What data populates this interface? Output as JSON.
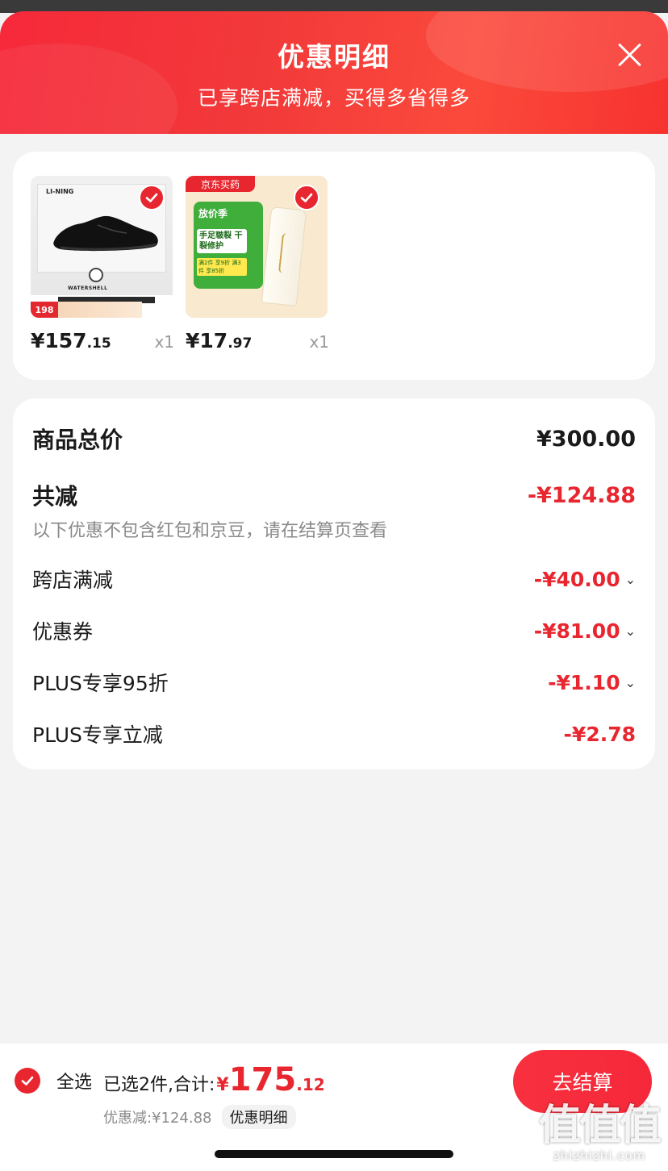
{
  "header": {
    "title": "优惠明细",
    "subtitle": "已享跨店满减，买得多省得多"
  },
  "products": [
    {
      "name": "shoe",
      "price_int": "¥157",
      "price_dec": ".15",
      "qty": "x1",
      "brand": "LI-NING",
      "tag": "WATERSHELL",
      "promo_price": "198"
    },
    {
      "name": "cream",
      "price_int": "¥17",
      "price_dec": ".97",
      "qty": "x1",
      "store_tag": "京东买药",
      "promo_title": "放价季",
      "promo_main": "手足皲裂 干裂修护",
      "promo_sub": "满2件 享9折 满3件 享85折"
    }
  ],
  "summary": {
    "total_label": "商品总价",
    "total_value": "¥300.00",
    "reduce_label": "共减",
    "reduce_value": "-¥124.88",
    "note": "以下优惠不包含红包和京豆，请在结算页查看",
    "items": [
      {
        "label": "跨店满减",
        "value": "-¥40.00",
        "expandable": true
      },
      {
        "label": "优惠券",
        "value": "-¥81.00",
        "expandable": true
      },
      {
        "label": "PLUS专享95折",
        "value": "-¥1.10",
        "expandable": true
      },
      {
        "label": "PLUS专享立减",
        "value": "-¥2.78",
        "expandable": false
      }
    ]
  },
  "footer": {
    "select_all": "全选",
    "selected_text": "已选2件,合计:",
    "sum_currency": "¥",
    "sum_int": "175",
    "sum_dec": ".12",
    "discount_text": "优惠减:¥124.88",
    "detail_label": "优惠明细",
    "checkout_label": "去结算"
  },
  "watermark": {
    "big": "值值值",
    "small": "zhizhizhi.com"
  },
  "colors": {
    "accent": "#e8262f",
    "header_red": "#f6293a"
  }
}
